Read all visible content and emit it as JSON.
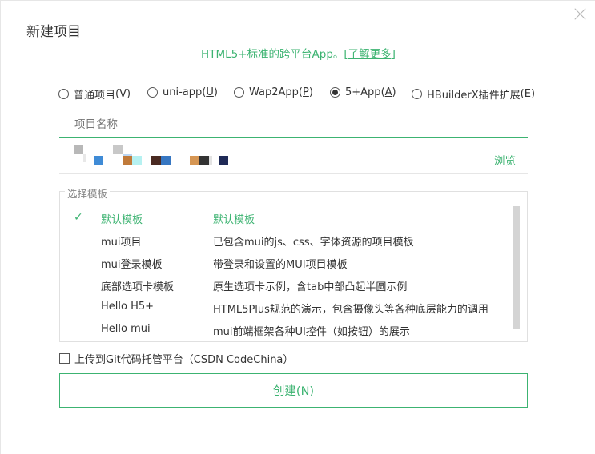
{
  "dialog": {
    "title": "新建项目",
    "subtitle": "HTML5+标准的跨平台App。",
    "learn_more": "[了解更多]"
  },
  "project_types": [
    {
      "label": "普通项目",
      "key": "V",
      "checked": false
    },
    {
      "label": "uni-app",
      "key": "U",
      "checked": false
    },
    {
      "label": "Wap2App",
      "key": "P",
      "checked": false
    },
    {
      "label": "5+App",
      "key": "A",
      "checked": true
    },
    {
      "label": "HBuilderX插件扩展",
      "key": "E",
      "checked": false
    }
  ],
  "project_name": {
    "placeholder": "项目名称",
    "value": ""
  },
  "location": {
    "path_text": "",
    "browse_label": "浏览"
  },
  "templates": {
    "legend": "选择模板",
    "selected_index": 0,
    "rows": [
      {
        "name": "默认模板",
        "desc": "默认模板"
      },
      {
        "name": "mui项目",
        "desc": "已包含mui的js、css、字体资源的项目模板"
      },
      {
        "name": "mui登录模板",
        "desc": "带登录和设置的MUI项目模板"
      },
      {
        "name": "底部选项卡模板",
        "desc": "原生选项卡示例，含tab中部凸起半圆示例"
      },
      {
        "name": "Hello H5+",
        "desc": "HTML5Plus规范的演示，包含摄像头等各种底层能力的调用"
      },
      {
        "name": "Hello mui",
        "desc": "mui前端框架各种UI控件（如按钮）的展示"
      }
    ]
  },
  "upload": {
    "label": "上传到Git代码托管平台（CSDN CodeChina）",
    "checked": false
  },
  "create_button": {
    "label": "创建",
    "key": "N"
  },
  "colors": {
    "accent": "#3cb371",
    "border": "#e0e0e0",
    "text": "#333333"
  }
}
